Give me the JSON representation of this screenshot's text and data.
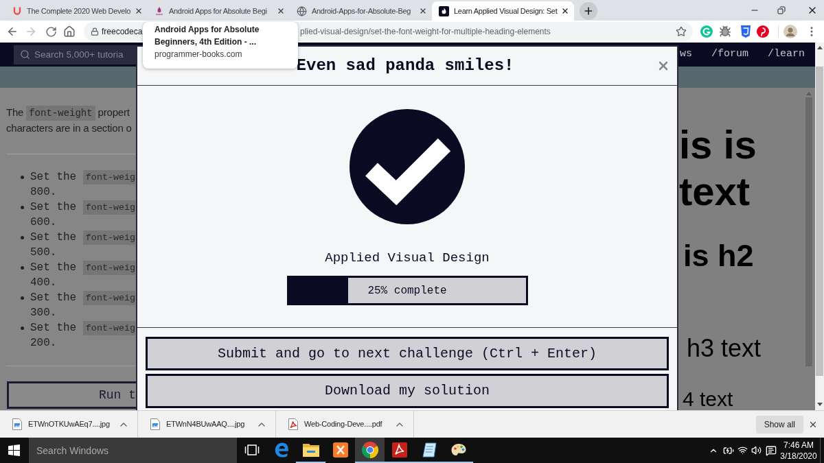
{
  "browser": {
    "tabs": [
      {
        "title": "The Complete 2020 Web Develo",
        "kind": "udemy",
        "selected": false
      },
      {
        "title": "Android Apps for Absolute Begi",
        "kind": "book",
        "selected": false
      },
      {
        "title": "Android-Apps-for-Absolute-Beg",
        "kind": "globe",
        "selected": false
      },
      {
        "title": "Learn Applied Visual Design: Set",
        "kind": "fcc",
        "selected": true
      }
    ],
    "address_bar": {
      "url_host": "freecodeca",
      "url_path": "plied-visual-design/set-the-font-weight-for-multiple-heading-elements"
    },
    "tooltip": {
      "title": "Android Apps for Absolute Beginners, 4th Edition - ...",
      "site": "programmer-books.com"
    }
  },
  "navbar": {
    "search": {
      "placeholder": "Search 5,000+ tutoria"
    },
    "links": [
      "ws",
      "/forum",
      "/learn"
    ]
  },
  "lesson": {
    "paragraph": [
      [
        {
          "kind": "text",
          "text": "The "
        },
        {
          "kind": "code",
          "text": "font-weight"
        },
        {
          "kind": "text",
          "text": " propert"
        }
      ],
      [
        {
          "kind": "text",
          "text": "characters are in a section o"
        }
      ]
    ],
    "tasks": [
      {
        "text": "Set the",
        "code": "font-weig",
        "value": "800."
      },
      {
        "text": "Set the",
        "code": "font-weig",
        "value": "600."
      },
      {
        "text": "Set the",
        "code": "font-weig",
        "value": "500."
      },
      {
        "text": "Set the",
        "code": "font-weig",
        "value": "400."
      },
      {
        "text": "Set the",
        "code": "font-weig",
        "value": "300."
      },
      {
        "text": "Set the",
        "code": "font-weig",
        "value": "200."
      }
    ],
    "run_button": "Run t"
  },
  "preview": {
    "lines": [
      {
        "kind": "h1",
        "text": "is is"
      },
      {
        "kind": "h1",
        "text": "text"
      },
      {
        "kind": "h2",
        "text": "is h2"
      },
      {
        "kind": "h3",
        "text": "h3 text"
      },
      {
        "kind": "h4",
        "text": "4 text"
      }
    ]
  },
  "modal": {
    "title": "Even sad panda smiles!",
    "course": "Applied Visual Design",
    "progress": {
      "level": 0.25,
      "label": "25% complete"
    },
    "buttons": [
      "Submit and go to next challenge (Ctrl + Enter)",
      "Download my solution"
    ]
  },
  "downloads": {
    "items": [
      {
        "name": "ETWnOTKUwAEq7....jpg",
        "kind": "image"
      },
      {
        "name": "ETWnN4BUwAAQ....jpg",
        "kind": "image"
      },
      {
        "name": "Web-Coding-Deve....pdf",
        "kind": "pdf"
      }
    ],
    "show_all": "Show all"
  },
  "taskbar": {
    "search": {
      "placeholder": "Search Windows"
    },
    "apps": [
      {
        "kind": "taskview",
        "open": false,
        "active": false
      },
      {
        "kind": "edge",
        "open": false,
        "active": false
      },
      {
        "kind": "explorer",
        "open": true,
        "active": false
      },
      {
        "kind": "xampp",
        "open": false,
        "active": false
      },
      {
        "kind": "chrome",
        "open": true,
        "active": true
      },
      {
        "kind": "acrobat",
        "open": true,
        "active": false
      },
      {
        "kind": "notepad",
        "open": true,
        "active": false
      },
      {
        "kind": "paint",
        "open": true,
        "active": false
      }
    ],
    "clock": {
      "time": "7:46 AM",
      "date": "3/18/2020"
    }
  }
}
